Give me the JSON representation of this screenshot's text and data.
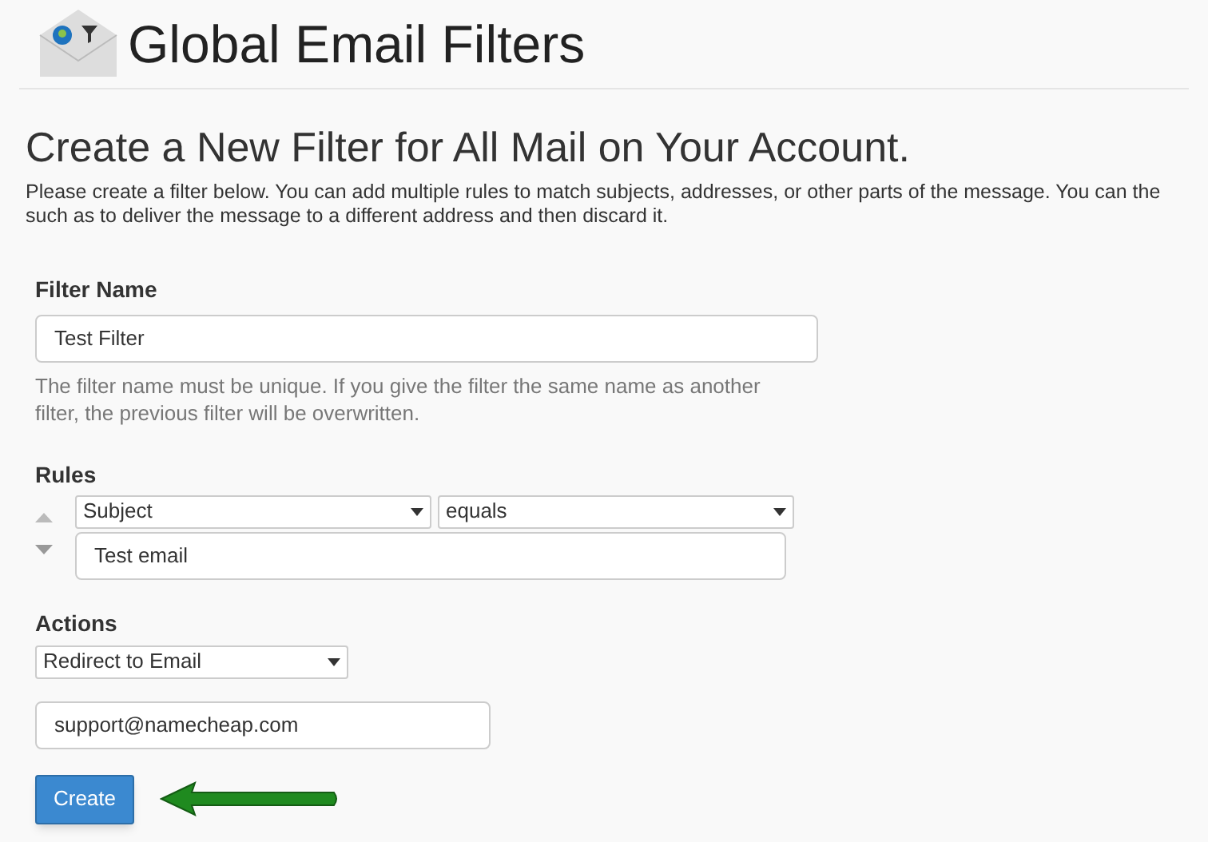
{
  "page_title": "Global Email Filters",
  "heading": "Create a New Filter for All Mail on Your Account.",
  "description": "Please create a filter below. You can add multiple rules to match subjects, addresses, or other parts of the message. You can the\nsuch as to deliver the message to a different address and then discard it.",
  "filter_name": {
    "label": "Filter Name",
    "value": "Test Filter",
    "help": "The filter name must be unique. If you give the filter the same name as another filter, the previous filter will be overwritten."
  },
  "rules": {
    "label": "Rules",
    "items": [
      {
        "field": "Subject",
        "operator": "equals",
        "value": "Test email"
      }
    ]
  },
  "actions": {
    "label": "Actions",
    "items": [
      {
        "action": "Redirect to Email",
        "value": "support@namecheap.com"
      }
    ]
  },
  "submit_button": "Create"
}
